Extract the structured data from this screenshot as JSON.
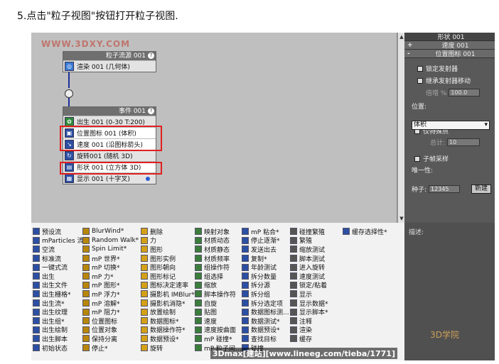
{
  "caption": "5.点击\"粒子视图\"按钮打开粒子视图.",
  "watermark_top": "WWW.3DXY.COM",
  "source_node": {
    "title": "粒子流源 001",
    "row": "渲染 001 (几何体)"
  },
  "event_node": {
    "title": "事件 001",
    "rows": [
      "出生 001 (0-30 T:200)",
      "位置图标 001 (体积)",
      "速度 001 (沿图标箭头)",
      "旋转001 (随机 3D)",
      "形状 001 (立方体 3D)",
      "显示 001 (十字叉)"
    ]
  },
  "right_panel": {
    "top_title": "形状 001",
    "velocity_bar": "速度 001",
    "position_bar": "位置图标 001",
    "lock_emitter": "锁定发射器",
    "inherit_motion": "继承发射器移动",
    "multiplier_label": "倍增 %",
    "multiplier_value": "100.0",
    "location_label": "位置:",
    "location_value": "体积",
    "distinct_points": "仅特殊点",
    "total_label": "总计:",
    "total_value": "10",
    "subframe": "子帧采样",
    "uniqueness_label": "唯一性:",
    "seed_label": "种子:",
    "seed_value": "12345",
    "new_button": "新建",
    "description_label": "描述:"
  },
  "depot": {
    "columns": [
      [
        "预设流",
        "mParticles 流*",
        "空流",
        "标准流",
        "一键式流",
        "出生",
        "出生文件",
        "出生栅格*",
        "出生流*",
        "出生纹理",
        "出生组*",
        "出生绘制",
        "出生脚本",
        "初始状态"
      ],
      [
        "BlurWind*",
        "Random Walk*",
        "Spin Limit*",
        "mP 世界*",
        "mP 切换*",
        "mP 力*",
        "mP 图形*",
        "mP 浮力*",
        "mP 溶解*",
        "mP 阻力*",
        "位置图标",
        "位置对象",
        "保持分离",
        "停止*"
      ],
      [
        "删除",
        "力",
        "图形",
        "图形实例",
        "图形朝向",
        "图形标记",
        "图标决定速率",
        "摄影机 IMBlur*",
        "摄影机消隐*",
        "放置绘制",
        "数据图标*",
        "数据操作符*",
        "数据预设*",
        "旋转"
      ],
      [
        "映射对象",
        "材质动态",
        "材质静态",
        "材质频率",
        "组操作符",
        "组选择",
        "缩放",
        "脚本操作符",
        "自旋",
        "贴图",
        "速度",
        "速度按曲面",
        "mP 碰撞*",
        "mP 粒子间..."
      ],
      [
        "mP 粘合*",
        "停止逐渐*",
        "发送出去",
        "复制*",
        "年龄测试",
        "拆分数量",
        "拆分源",
        "拆分组",
        "拆分选定项",
        "数据图标测...",
        "数据测试*",
        "数据预设*",
        "查找目标",
        "碰撞"
      ],
      [
        "碰撞繁殖",
        "繁殖",
        "缩放测试",
        "脚本测试",
        "进入旋转",
        "速度测试",
        "锁定/粘着",
        "显示",
        "显示数据*",
        "显示脚本*",
        "注释",
        "渲染",
        "缓存",
        ""
      ],
      [
        "缓存选择性*"
      ]
    ]
  },
  "watermark_bottom": "3Dmax[建站][www.lineeg.com/tieba/1771]",
  "watermark_logo": "3D学院"
}
